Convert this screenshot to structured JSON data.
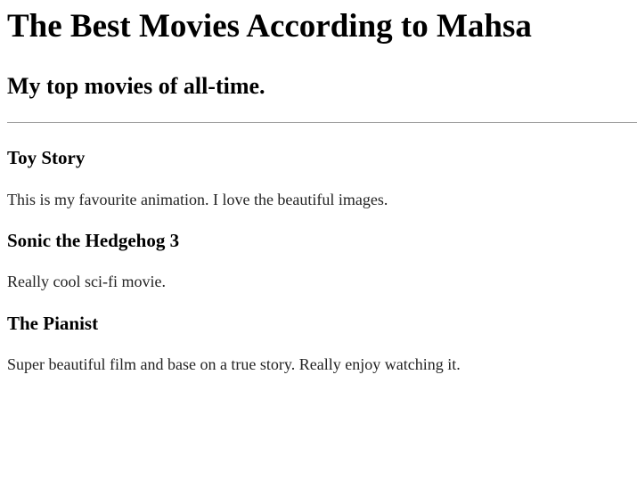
{
  "header": {
    "title": "The Best Movies According to Mahsa",
    "subtitle": "My top movies of all-time."
  },
  "movies": [
    {
      "title": "Toy Story",
      "description": "This is my favourite animation. I love the beautiful images."
    },
    {
      "title": "Sonic the Hedgehog 3",
      "description": "Really cool sci-fi movie."
    },
    {
      "title": "The Pianist",
      "description": "Super beautiful film and base on a true story. Really enjoy watching it."
    }
  ]
}
